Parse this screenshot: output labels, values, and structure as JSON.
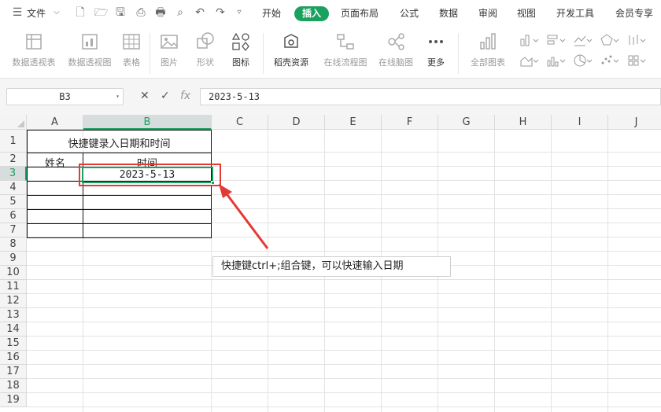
{
  "topbar": {
    "menu_label": "文件",
    "tabs": [
      "开始",
      "插入",
      "页面布局",
      "公式",
      "数据",
      "审阅",
      "视图",
      "开发工具",
      "会员专享"
    ]
  },
  "ribbon": {
    "buttons": [
      "数据透视表",
      "数据透视图",
      "表格",
      "图片",
      "形状",
      "图标",
      "稻壳资源",
      "在线流程图",
      "在线脑图",
      "更多",
      "全部图表"
    ]
  },
  "formula_bar": {
    "cell_ref": "B3",
    "formula": "2023-5-13",
    "fx_label": "fx"
  },
  "sheet": {
    "columns": [
      "A",
      "B",
      "C",
      "D",
      "E",
      "F",
      "G",
      "H",
      "I",
      "J"
    ],
    "rows": [
      "1",
      "2",
      "3",
      "4",
      "5",
      "6",
      "7",
      "8",
      "9",
      "10",
      "11",
      "12",
      "13",
      "14",
      "15",
      "16",
      "17",
      "18",
      "19"
    ],
    "title": "快捷键录入日期和时间",
    "header_name": "姓名",
    "header_time": "时间",
    "b3_value": "2023-5-13"
  },
  "annotation": {
    "note": "快捷键ctrl+;组合键，可以快速输入日期",
    "accent_color": "#1aa15f",
    "highlight_color": "#e53935"
  }
}
